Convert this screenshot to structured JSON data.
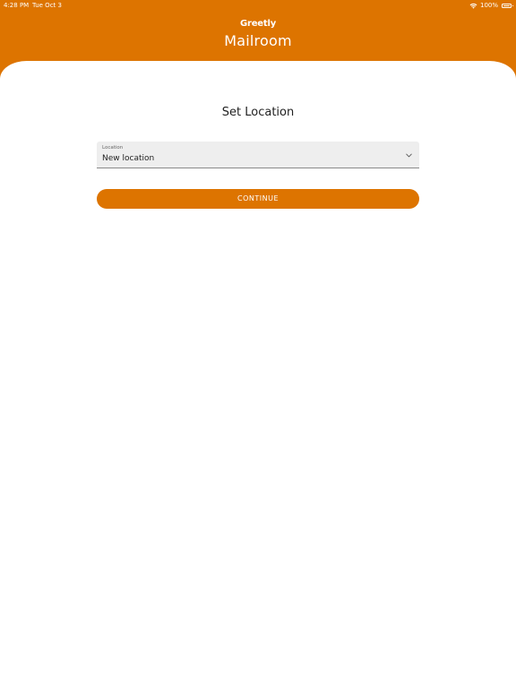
{
  "status_bar": {
    "time": "4:28 PM",
    "date": "Tue Oct 3",
    "battery": "100%",
    "wifi_icon": "wifi-icon",
    "battery_icon": "battery-icon"
  },
  "header": {
    "brand": "Greetly",
    "title": "Mailroom",
    "background_color": "#dd7400"
  },
  "main": {
    "title": "Set Location",
    "location_select": {
      "label": "Location",
      "value": "New location",
      "icon": "chevron-down-icon"
    },
    "continue_button": {
      "label": "CONTINUE",
      "color": "#dd7400"
    }
  }
}
